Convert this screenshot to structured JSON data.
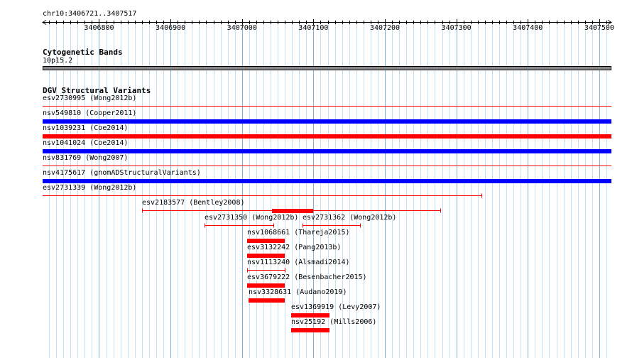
{
  "ruler": {
    "range_label": "chr10:3406721..3407517",
    "start": 3406721,
    "end": 3407517,
    "ticks": [
      "3406800",
      "3406900",
      "3407000",
      "3407100",
      "3407200",
      "3407300",
      "3407400",
      "3407500"
    ]
  },
  "cytoband_track": {
    "title": "Cytogenetic Bands",
    "band_label": "10p15.2",
    "band_color": "#888888"
  },
  "sv_track": {
    "title": "DGV Structural Variants",
    "colors": {
      "loss": "#ff0000",
      "gain": "#0000ff"
    },
    "features": [
      {
        "label": "esv2730995 (Wong2012b)",
        "start": 3406721,
        "end": 3407517,
        "type": "loss",
        "style": "line"
      },
      {
        "label": "nsv549810 (Cooper2011)",
        "start": 3406721,
        "end": 3407517,
        "type": "gain",
        "style": "bar"
      },
      {
        "label": "nsv1039231 (Coe2014)",
        "start": 3406721,
        "end": 3407517,
        "type": "loss",
        "style": "bar"
      },
      {
        "label": "nsv1041024 (Coe2014)",
        "start": 3406721,
        "end": 3407517,
        "type": "gain",
        "style": "bar"
      },
      {
        "label": "nsv831769 (Wong2007)",
        "start": 3406721,
        "end": 3407517,
        "type": "loss",
        "style": "line"
      },
      {
        "label": "nsv4175617 (gnomADStructuralVariants)",
        "start": 3406721,
        "end": 3407517,
        "type": "gain",
        "style": "bar"
      },
      {
        "label": "esv2731339 (Wong2012b)",
        "start": 3406721,
        "end": 3407335,
        "type": "loss",
        "style": "line"
      },
      {
        "label": "esv2183577 (Bentley2008)",
        "start": 3406860,
        "end": 3407278,
        "type": "loss",
        "style": "line",
        "thick_start": 3407042,
        "thick_end": 3407100
      },
      {
        "label": "esv2731350 (Wong2012b)",
        "start": 3406948,
        "end": 3407044,
        "type": "loss",
        "style": "line"
      },
      {
        "label": "esv2731362 (Wong2012b)",
        "start": 3407085,
        "end": 3407165,
        "type": "loss",
        "style": "line"
      },
      {
        "label": "nsv1068661 (Thareja2015)",
        "start": 3407007,
        "end": 3407060,
        "type": "loss",
        "style": "bar"
      },
      {
        "label": "esv3132242 (Pang2013b)",
        "start": 3407007,
        "end": 3407060,
        "type": "loss",
        "style": "bar"
      },
      {
        "label": "nsv1113240 (Alsmadi2014)",
        "start": 3407007,
        "end": 3407060,
        "type": "loss",
        "style": "line"
      },
      {
        "label": "esv3679222 (Besenbacher2015)",
        "start": 3407007,
        "end": 3407060,
        "type": "loss",
        "style": "bar"
      },
      {
        "label": "nsv3328631 (Audano2019)",
        "start": 3407009,
        "end": 3407060,
        "type": "loss",
        "style": "bar"
      },
      {
        "label": "esv1369919 (Levy2007)",
        "start": 3407069,
        "end": 3407122,
        "type": "loss",
        "style": "bar"
      },
      {
        "label": "nsv25192 (Mills2006)",
        "start": 3407069,
        "end": 3407122,
        "type": "loss",
        "style": "bar"
      }
    ]
  }
}
